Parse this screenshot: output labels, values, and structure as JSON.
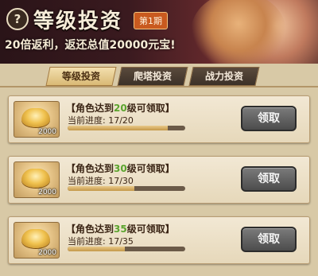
{
  "header": {
    "help_symbol": "?",
    "title": "等级投资",
    "period": "第1期",
    "subtitle": "20倍返利，返还总值20000元宝!"
  },
  "tabs": [
    {
      "label": "等级投资",
      "active": true
    },
    {
      "label": "爬塔投资",
      "active": false
    },
    {
      "label": "战力投资",
      "active": false
    }
  ],
  "rewards": [
    {
      "prefix": "【角色达到",
      "level": "20",
      "suffix": "级可领取】",
      "progress_label": "当前进度:",
      "progress_text": "17/20",
      "progress": 0.85,
      "item_count": "2000",
      "button": "领取"
    },
    {
      "prefix": "【角色达到",
      "level": "30",
      "suffix": "级可领取】",
      "progress_label": "当前进度:",
      "progress_text": "17/30",
      "progress": 0.567,
      "item_count": "2000",
      "button": "领取"
    },
    {
      "prefix": "【角色达到",
      "level": "35",
      "suffix": "级可领取】",
      "progress_label": "当前进度:",
      "progress_text": "17/35",
      "progress": 0.486,
      "item_count": "2000",
      "button": "领取"
    }
  ]
}
